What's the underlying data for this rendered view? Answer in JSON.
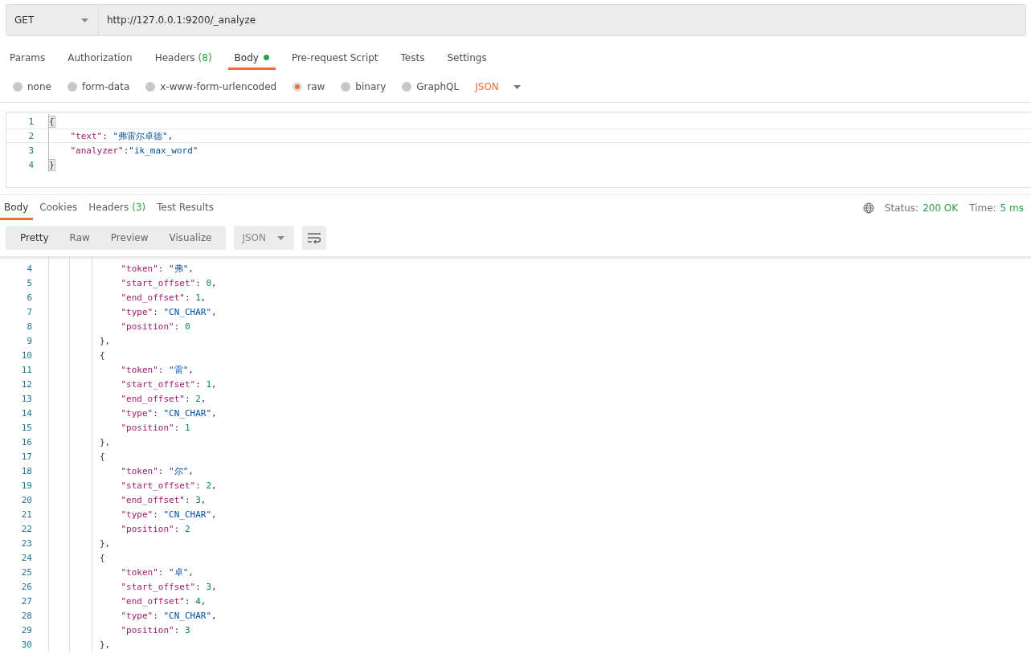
{
  "request": {
    "method": "GET",
    "url": "http://127.0.0.1:9200/_analyze"
  },
  "request_tabs": [
    {
      "label": "Params",
      "selected": false
    },
    {
      "label": "Authorization",
      "selected": false
    },
    {
      "label": "Headers",
      "count": "(8)",
      "selected": false
    },
    {
      "label": "Body",
      "dot": true,
      "selected": true
    },
    {
      "label": "Pre-request Script",
      "selected": false
    },
    {
      "label": "Tests",
      "selected": false
    },
    {
      "label": "Settings",
      "selected": false
    }
  ],
  "body_types": [
    {
      "label": "none",
      "selected": false
    },
    {
      "label": "form-data",
      "selected": false
    },
    {
      "label": "x-www-form-urlencoded",
      "selected": false
    },
    {
      "label": "raw",
      "selected": true
    },
    {
      "label": "binary",
      "selected": false
    },
    {
      "label": "GraphQL",
      "selected": false
    }
  ],
  "body_format": "JSON",
  "request_body": [
    {
      "number": "1",
      "tokens": [
        {
          "kind": "bracket",
          "text": "{"
        }
      ]
    },
    {
      "number": "2",
      "tokens": [
        {
          "kind": "key",
          "text": "    \"text\""
        },
        {
          "kind": "punct",
          "text": ": "
        },
        {
          "kind": "string",
          "text": "\"弗雷尔卓德\""
        },
        {
          "kind": "punct",
          "text": ","
        }
      ]
    },
    {
      "number": "3",
      "tokens": [
        {
          "kind": "key",
          "text": "    \"analyzer\""
        },
        {
          "kind": "punct",
          "text": ":"
        },
        {
          "kind": "string",
          "text": "\"ik_max_word\""
        }
      ]
    },
    {
      "number": "4",
      "tokens": [
        {
          "kind": "bracket",
          "text": "}"
        }
      ]
    }
  ],
  "response_tabs": [
    {
      "label": "Body",
      "selected": true
    },
    {
      "label": "Cookies",
      "selected": false
    },
    {
      "label": "Headers",
      "count": "(3)",
      "selected": false
    },
    {
      "label": "Test Results",
      "selected": false
    }
  ],
  "status": {
    "label": "Status:",
    "value": "200 OK",
    "time_label": "Time:",
    "time": "5 ms"
  },
  "view_modes": [
    {
      "label": "Pretty",
      "selected": true
    },
    {
      "label": "Raw",
      "selected": false
    },
    {
      "label": "Preview",
      "selected": false
    },
    {
      "label": "Visualize",
      "selected": false
    }
  ],
  "response_format": "JSON",
  "response_body": [
    {
      "number": "4",
      "tokens": [
        {
          "kind": "key",
          "text": "            \"token\""
        },
        {
          "kind": "punct",
          "text": ": "
        },
        {
          "kind": "string",
          "text": "\"弗\""
        },
        {
          "kind": "punct",
          "text": ","
        }
      ]
    },
    {
      "number": "5",
      "tokens": [
        {
          "kind": "key",
          "text": "            \"start_offset\""
        },
        {
          "kind": "punct",
          "text": ": "
        },
        {
          "kind": "number",
          "text": "0"
        },
        {
          "kind": "punct",
          "text": ","
        }
      ]
    },
    {
      "number": "6",
      "tokens": [
        {
          "kind": "key",
          "text": "            \"end_offset\""
        },
        {
          "kind": "punct",
          "text": ": "
        },
        {
          "kind": "number",
          "text": "1"
        },
        {
          "kind": "punct",
          "text": ","
        }
      ]
    },
    {
      "number": "7",
      "tokens": [
        {
          "kind": "key",
          "text": "            \"type\""
        },
        {
          "kind": "punct",
          "text": ": "
        },
        {
          "kind": "string",
          "text": "\"CN_CHAR\""
        },
        {
          "kind": "punct",
          "text": ","
        }
      ]
    },
    {
      "number": "8",
      "tokens": [
        {
          "kind": "key",
          "text": "            \"position\""
        },
        {
          "kind": "punct",
          "text": ": "
        },
        {
          "kind": "number",
          "text": "0"
        }
      ]
    },
    {
      "number": "9",
      "tokens": [
        {
          "kind": "punct",
          "text": "        },"
        }
      ]
    },
    {
      "number": "10",
      "tokens": [
        {
          "kind": "punct",
          "text": "        {"
        }
      ]
    },
    {
      "number": "11",
      "tokens": [
        {
          "kind": "key",
          "text": "            \"token\""
        },
        {
          "kind": "punct",
          "text": ": "
        },
        {
          "kind": "string",
          "text": "\"雷\""
        },
        {
          "kind": "punct",
          "text": ","
        }
      ]
    },
    {
      "number": "12",
      "tokens": [
        {
          "kind": "key",
          "text": "            \"start_offset\""
        },
        {
          "kind": "punct",
          "text": ": "
        },
        {
          "kind": "number",
          "text": "1"
        },
        {
          "kind": "punct",
          "text": ","
        }
      ]
    },
    {
      "number": "13",
      "tokens": [
        {
          "kind": "key",
          "text": "            \"end_offset\""
        },
        {
          "kind": "punct",
          "text": ": "
        },
        {
          "kind": "number",
          "text": "2"
        },
        {
          "kind": "punct",
          "text": ","
        }
      ]
    },
    {
      "number": "14",
      "tokens": [
        {
          "kind": "key",
          "text": "            \"type\""
        },
        {
          "kind": "punct",
          "text": ": "
        },
        {
          "kind": "string",
          "text": "\"CN_CHAR\""
        },
        {
          "kind": "punct",
          "text": ","
        }
      ]
    },
    {
      "number": "15",
      "tokens": [
        {
          "kind": "key",
          "text": "            \"position\""
        },
        {
          "kind": "punct",
          "text": ": "
        },
        {
          "kind": "number",
          "text": "1"
        }
      ]
    },
    {
      "number": "16",
      "tokens": [
        {
          "kind": "punct",
          "text": "        },"
        }
      ]
    },
    {
      "number": "17",
      "tokens": [
        {
          "kind": "punct",
          "text": "        {"
        }
      ]
    },
    {
      "number": "18",
      "tokens": [
        {
          "kind": "key",
          "text": "            \"token\""
        },
        {
          "kind": "punct",
          "text": ": "
        },
        {
          "kind": "string",
          "text": "\"尔\""
        },
        {
          "kind": "punct",
          "text": ","
        }
      ]
    },
    {
      "number": "19",
      "tokens": [
        {
          "kind": "key",
          "text": "            \"start_offset\""
        },
        {
          "kind": "punct",
          "text": ": "
        },
        {
          "kind": "number",
          "text": "2"
        },
        {
          "kind": "punct",
          "text": ","
        }
      ]
    },
    {
      "number": "20",
      "tokens": [
        {
          "kind": "key",
          "text": "            \"end_offset\""
        },
        {
          "kind": "punct",
          "text": ": "
        },
        {
          "kind": "number",
          "text": "3"
        },
        {
          "kind": "punct",
          "text": ","
        }
      ]
    },
    {
      "number": "21",
      "tokens": [
        {
          "kind": "key",
          "text": "            \"type\""
        },
        {
          "kind": "punct",
          "text": ": "
        },
        {
          "kind": "string",
          "text": "\"CN_CHAR\""
        },
        {
          "kind": "punct",
          "text": ","
        }
      ]
    },
    {
      "number": "22",
      "tokens": [
        {
          "kind": "key",
          "text": "            \"position\""
        },
        {
          "kind": "punct",
          "text": ": "
        },
        {
          "kind": "number",
          "text": "2"
        }
      ]
    },
    {
      "number": "23",
      "tokens": [
        {
          "kind": "punct",
          "text": "        },"
        }
      ]
    },
    {
      "number": "24",
      "tokens": [
        {
          "kind": "punct",
          "text": "        {"
        }
      ]
    },
    {
      "number": "25",
      "tokens": [
        {
          "kind": "key",
          "text": "            \"token\""
        },
        {
          "kind": "punct",
          "text": ": "
        },
        {
          "kind": "string",
          "text": "\"卓\""
        },
        {
          "kind": "punct",
          "text": ","
        }
      ]
    },
    {
      "number": "26",
      "tokens": [
        {
          "kind": "key",
          "text": "            \"start_offset\""
        },
        {
          "kind": "punct",
          "text": ": "
        },
        {
          "kind": "number",
          "text": "3"
        },
        {
          "kind": "punct",
          "text": ","
        }
      ]
    },
    {
      "number": "27",
      "tokens": [
        {
          "kind": "key",
          "text": "            \"end_offset\""
        },
        {
          "kind": "punct",
          "text": ": "
        },
        {
          "kind": "number",
          "text": "4"
        },
        {
          "kind": "punct",
          "text": ","
        }
      ]
    },
    {
      "number": "28",
      "tokens": [
        {
          "kind": "key",
          "text": "            \"type\""
        },
        {
          "kind": "punct",
          "text": ": "
        },
        {
          "kind": "string",
          "text": "\"CN_CHAR\""
        },
        {
          "kind": "punct",
          "text": ","
        }
      ]
    },
    {
      "number": "29",
      "tokens": [
        {
          "kind": "key",
          "text": "            \"position\""
        },
        {
          "kind": "punct",
          "text": ": "
        },
        {
          "kind": "number",
          "text": "3"
        }
      ]
    },
    {
      "number": "30",
      "tokens": [
        {
          "kind": "punct",
          "text": "        },"
        }
      ]
    }
  ]
}
